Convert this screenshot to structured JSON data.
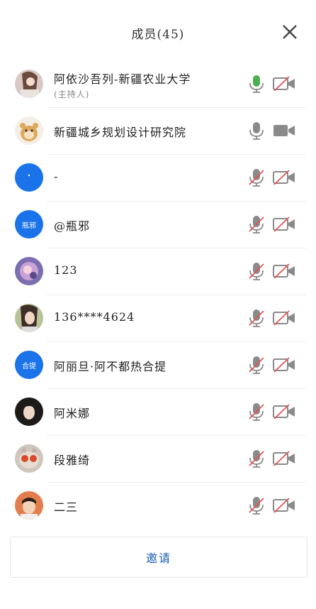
{
  "header": {
    "title": "成员(45)"
  },
  "members": [
    {
      "name": "阿依沙吾列-新疆农业大学",
      "role": "(主持人)",
      "avatar": "photo-woman",
      "mic": "on",
      "cam": "off"
    },
    {
      "name": "新疆城乡规划设计研究院",
      "avatar": "photo-hamster",
      "mic": "neutral",
      "cam": "on"
    },
    {
      "name": "-",
      "avatar": "blue-dot",
      "mic": "off",
      "cam": "off"
    },
    {
      "name": "@瓶邪",
      "avatar": "blue-text",
      "avatar_text": "瓶邪",
      "mic": "off",
      "cam": "off"
    },
    {
      "name": "123",
      "avatar": "photo-cartoon",
      "mic": "off",
      "cam": "off"
    },
    {
      "name": "136****4624",
      "avatar": "photo-girl",
      "mic": "off",
      "cam": "off"
    },
    {
      "name": "阿丽旦·阿不都热合提",
      "avatar": "blue-text",
      "avatar_text": "合提",
      "mic": "off",
      "cam": "off"
    },
    {
      "name": "阿米娜",
      "avatar": "photo-woman2",
      "mic": "off",
      "cam": "off"
    },
    {
      "name": "段雅绮",
      "avatar": "photo-cat",
      "mic": "off",
      "cam": "off"
    },
    {
      "name": "二三",
      "avatar": "photo-kid",
      "mic": "off",
      "cam": "off"
    }
  ],
  "footer": {
    "invite_label": "邀请"
  },
  "colors": {
    "accent": "#1a73e8",
    "mic_on": "#4caf50",
    "slash": "#e05555",
    "icon_gray": "#8a8a8a"
  }
}
